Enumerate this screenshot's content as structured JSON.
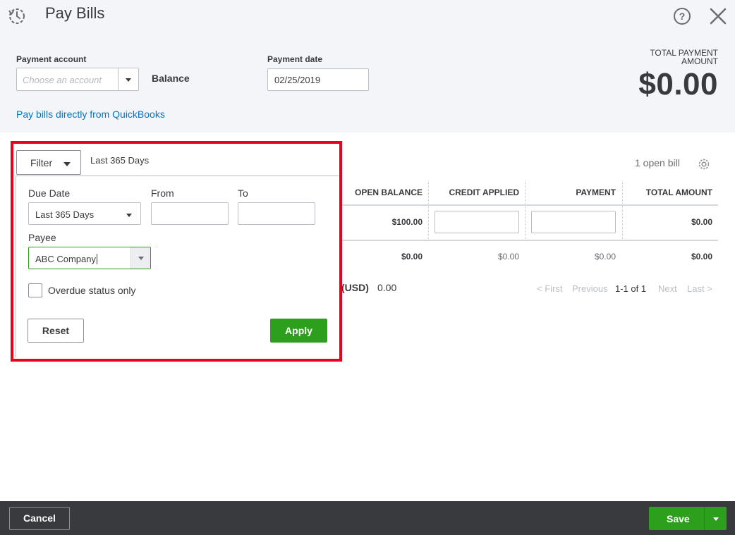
{
  "header": {
    "title": "Pay Bills",
    "payment_account_label": "Payment account",
    "payment_account_placeholder": "Choose an account",
    "balance_label": "Balance",
    "payment_date_label": "Payment date",
    "payment_date_value": "02/25/2019",
    "pay_link": "Pay bills directly from QuickBooks",
    "total_label": "TOTAL PAYMENT AMOUNT",
    "total_amount": "$0.00"
  },
  "table": {
    "open_bills": "1 open bill",
    "columns": [
      "OPEN BALANCE",
      "CREDIT APPLIED",
      "PAYMENT",
      "TOTAL AMOUNT"
    ],
    "row": {
      "open_balance": "$100.00",
      "total_amount": "$0.00"
    },
    "totals": {
      "open_balance": "$0.00",
      "credit_applied": "$0.00",
      "payment": "$0.00",
      "total_amount": "$0.00"
    },
    "usd_label": "(USD)",
    "usd_value": "0.00"
  },
  "pagination": {
    "first": "< First",
    "previous": "Previous",
    "range": "1-1 of 1",
    "next": "Next",
    "last": "Last >"
  },
  "filter": {
    "button_label": "Filter",
    "current_range": "Last 365 Days",
    "due_date_label": "Due Date",
    "due_date_value": "Last 365 Days",
    "from_label": "From",
    "to_label": "To",
    "payee_label": "Payee",
    "payee_value": "ABC Company",
    "overdue_label": "Overdue status only",
    "overdue_checked": false,
    "reset_label": "Reset",
    "apply_label": "Apply"
  },
  "footer": {
    "cancel_label": "Cancel",
    "save_label": "Save"
  },
  "colors": {
    "brand_green": "#2ca01c",
    "link_blue": "#0077c5",
    "highlight_red": "#e8001c",
    "footer_bg": "#393a3d"
  },
  "icons": [
    "history-icon",
    "help-icon",
    "close-icon",
    "gear-icon",
    "chevron-down-icon"
  ]
}
